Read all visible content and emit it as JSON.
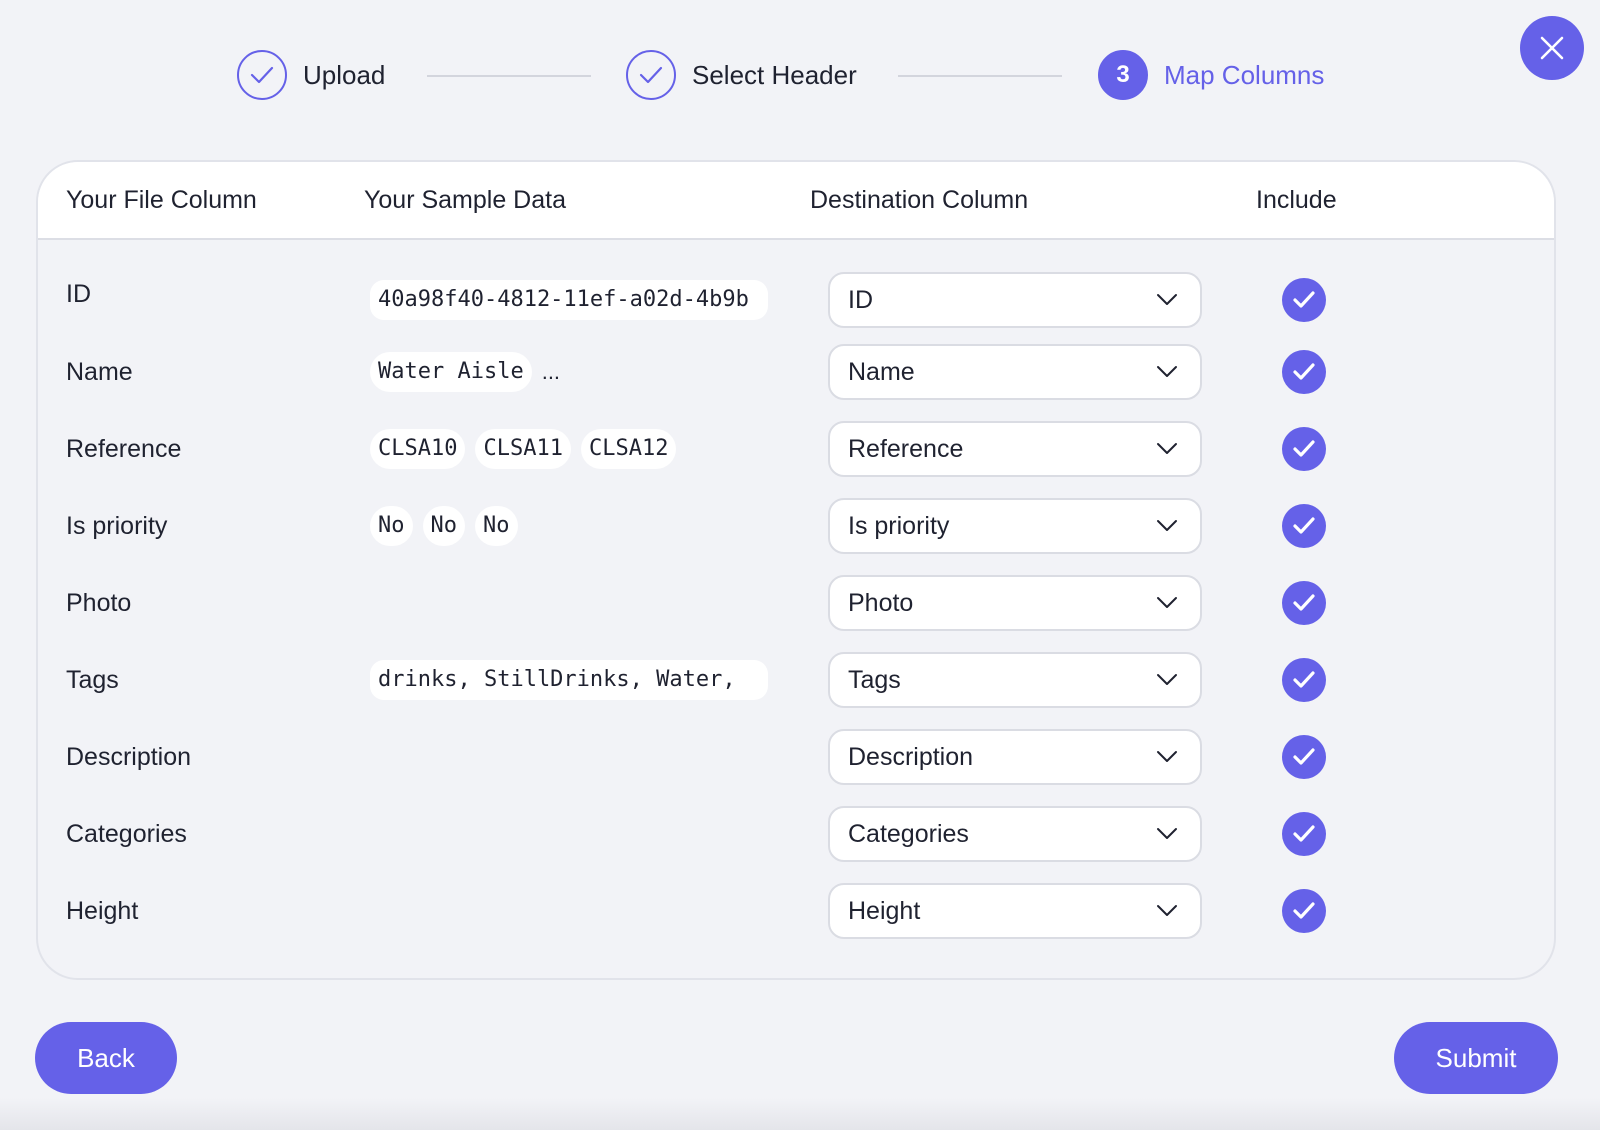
{
  "stepper": {
    "steps": [
      {
        "label": "Upload",
        "state": "done"
      },
      {
        "label": "Select Header",
        "state": "done"
      },
      {
        "label": "Map Columns",
        "number": "3",
        "state": "active"
      }
    ]
  },
  "table": {
    "headers": {
      "file_column": "Your File Column",
      "sample_data": "Your Sample Data",
      "destination": "Destination Column",
      "include": "Include"
    },
    "rows": [
      {
        "file": "ID",
        "samples": [
          "40a98f40-4812-11ef-a02d-4b9b"
        ],
        "dest": "ID",
        "include": true
      },
      {
        "file": "Name",
        "samples": [
          "Water Aisle"
        ],
        "more": "...",
        "dest": "Name",
        "include": true
      },
      {
        "file": "Reference",
        "samples": [
          "CLSA10",
          "CLSA11",
          "CLSA12"
        ],
        "dest": "Reference",
        "include": true
      },
      {
        "file": "Is priority",
        "samples": [
          "No",
          "No",
          "No"
        ],
        "dest": "Is priority",
        "include": true
      },
      {
        "file": "Photo",
        "samples": [],
        "dest": "Photo",
        "include": true
      },
      {
        "file": "Tags",
        "samples": [
          "drinks, StillDrinks, Water,"
        ],
        "dest": "Tags",
        "include": true
      },
      {
        "file": "Description",
        "samples": [],
        "dest": "Description",
        "include": true
      },
      {
        "file": "Categories",
        "samples": [],
        "dest": "Categories",
        "include": true
      },
      {
        "file": "Height",
        "samples": [],
        "dest": "Height",
        "include": true
      }
    ]
  },
  "actions": {
    "back": "Back",
    "submit": "Submit"
  },
  "icons": {
    "close": "close-icon",
    "step_done": "check-icon",
    "dropdown": "chevron-down-icon",
    "include": "checkbox-checked-icon"
  },
  "colors": {
    "accent": "#6561e8",
    "background": "#f2f3f7",
    "surface": "#ffffff"
  }
}
